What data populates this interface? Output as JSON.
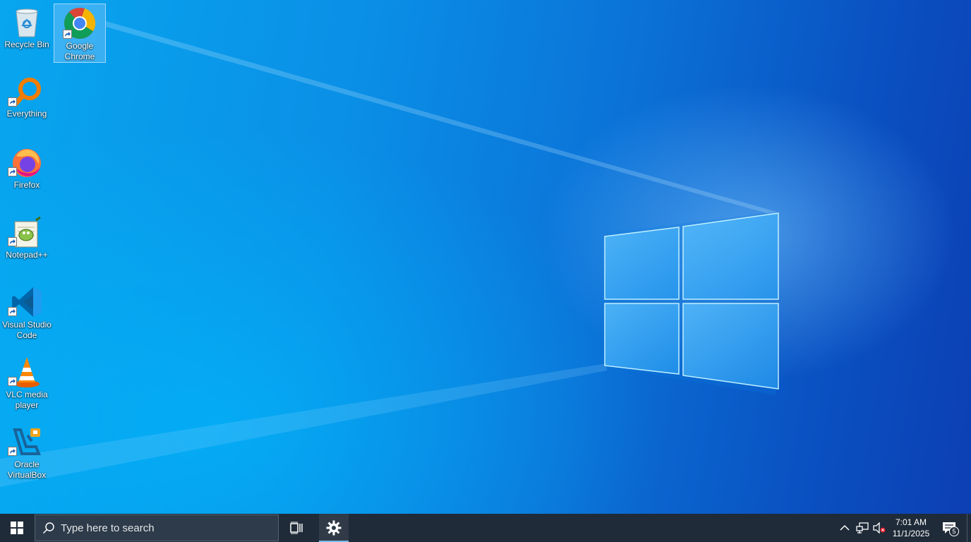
{
  "desktop": {
    "icons": [
      {
        "label": "Recycle Bin"
      },
      {
        "label": "Google Chrome"
      },
      {
        "label": "Everything"
      },
      {
        "label": "Firefox"
      },
      {
        "label": "Notepad++"
      },
      {
        "label": "Visual Studio Code"
      },
      {
        "label": "VLC media player"
      },
      {
        "label": "Oracle VirtualBox"
      }
    ]
  },
  "taskbar": {
    "search_placeholder": "Type here to search",
    "pinned": [
      "windows-start-icon",
      "task-view-icon",
      "settings-gear-icon"
    ],
    "tray": {
      "icons": [
        "chevron-up-icon",
        "network-icon",
        "volume-muted-icon"
      ],
      "time": "7:01 AM",
      "date": "11/1/2025",
      "notification_count": "5"
    }
  },
  "colors": {
    "taskbar_bg": "#1f2b38",
    "accent": "#76b9ed",
    "wallpaper_blue": "#0a8fe6"
  }
}
